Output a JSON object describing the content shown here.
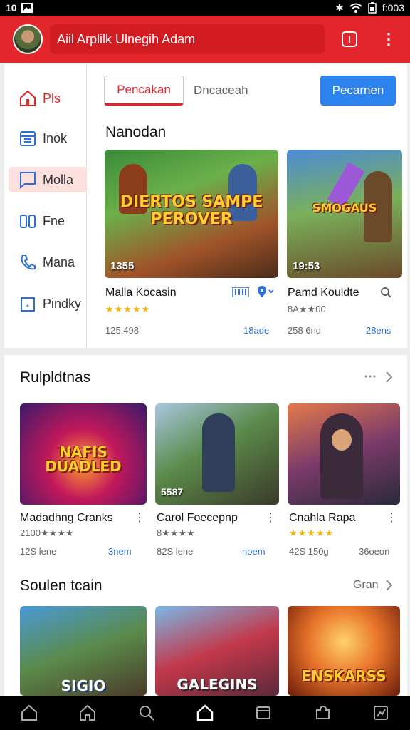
{
  "status_bar": {
    "left": "10",
    "time": "f:003"
  },
  "app_bar": {
    "search_text": "Aiil Arplilk Ulnegih Adam"
  },
  "sidebar": {
    "items": [
      {
        "label": "Pls",
        "icon": "home-icon"
      },
      {
        "label": "Inok",
        "icon": "calendar-icon"
      },
      {
        "label": "Molla",
        "icon": "chat-icon"
      },
      {
        "label": "Fne",
        "icon": "book-icon"
      },
      {
        "label": "Mana",
        "icon": "phone-icon"
      },
      {
        "label": "Pindky",
        "icon": "doc-icon"
      }
    ]
  },
  "tabs": {
    "selected": "Pencakan",
    "plain": "Dncaceah",
    "primary": "Pecarnen"
  },
  "featured": {
    "title": "Nanodan",
    "cards": [
      {
        "logo": "DIERTOS SAMPE PEROVER",
        "duration": "1355",
        "title": "Malla Kocasin",
        "stars": "★★★★★",
        "rating_text": "",
        "meta": "125.498",
        "link": "18ade"
      },
      {
        "logo": "SMOGAUS",
        "duration": "19:53",
        "title": "Pamd Kouldte",
        "stars": "",
        "rating_text": "8A★★00",
        "meta": "258 6nd",
        "link": "28ens"
      }
    ]
  },
  "row1": {
    "title": "Rulpldtnas",
    "more_label": "",
    "cards": [
      {
        "logo": "NAFIS DUADLED",
        "badge": "",
        "title": "Madadhng  Cranks",
        "rating_text": "2100★★★★",
        "meta": "12S lene",
        "link": "3nem"
      },
      {
        "logo": "",
        "badge": "5587",
        "title": "Carol Foecepnp",
        "rating_text": "8★★★★",
        "meta": "82S lene",
        "link": "noem"
      },
      {
        "logo": "",
        "badge": "",
        "title": "Cnahla Rapa",
        "rating_text": "★★★★★",
        "meta": "42S 150g",
        "link": "36oeon"
      }
    ]
  },
  "row2": {
    "title": "Soulen tcain",
    "more_label": "Gran",
    "cards": [
      {
        "logo": "SIGIO"
      },
      {
        "logo": "GALEGINS"
      },
      {
        "logo": "ENSKARSS"
      }
    ]
  },
  "colors": {
    "brand_red": "#e2262c",
    "accent_blue": "#2d83ee",
    "star_gold": "#f5b400"
  }
}
